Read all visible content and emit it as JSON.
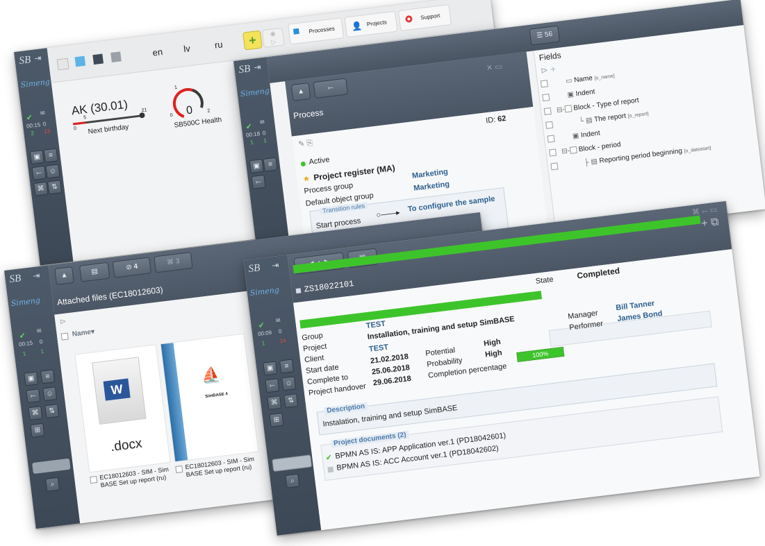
{
  "dashboard": {
    "languages": [
      "en",
      "lv",
      "ru"
    ],
    "toolbar": {
      "processes": "Processes",
      "projects": "Projects",
      "support": "Support"
    },
    "gauge1": {
      "title": "AK (30.01)",
      "min": "0",
      "marker": "5",
      "max": "21",
      "caption": "Next birthday"
    },
    "gauge2": {
      "top": "1",
      "min": "0",
      "max": "2",
      "value": "0",
      "caption": "SB500C Health"
    },
    "nav": {
      "time": "00:15",
      "mail": "0",
      "users": "2",
      "flags": "13"
    }
  },
  "process": {
    "badge": "56",
    "title": "Process",
    "id_label": "ID:",
    "id_value": "62",
    "status": "Active",
    "name": "Project register (MA)",
    "process_group_label": "Process group",
    "process_group": "Marketing",
    "default_group_label": "Default object group",
    "default_group": "Marketing",
    "transition_rules": "Transition rules",
    "start_process": "Start process",
    "configure": "To configure the sample",
    "nav": {
      "time": "00:18",
      "mail": "0",
      "users": "1",
      "flags": "1"
    }
  },
  "fields": {
    "title": "Fields",
    "items": [
      {
        "label": "Name",
        "code": "[o_name]"
      },
      {
        "label": "Indent",
        "code": ""
      },
      {
        "label": "Block - Type of report",
        "code": ""
      },
      {
        "label": "The report",
        "code": "[o_report]"
      },
      {
        "label": "Indent",
        "code": ""
      },
      {
        "label": "Block - period",
        "code": ""
      },
      {
        "label": "Reporting period beginning",
        "code": "[o_datestart]"
      }
    ]
  },
  "files": {
    "attach_count": "4",
    "network_count": "3",
    "title": "Attached files (EC18012603)",
    "column_name": "Name",
    "docx_ext": ".docx",
    "file1_name": "EC18012603 - SIM - Sim BASE Set up report (ru)",
    "file2_name": "EC18012603 - SIM - Sim BASE Set up report (ru)",
    "doc_heading": "SimBASE 4",
    "nav": {
      "time": "00:15",
      "mail": "0",
      "users": "1",
      "flags": "1"
    }
  },
  "project": {
    "code": "ZS18022101",
    "state_label": "State",
    "state": "Completed",
    "group_label": "Group",
    "group": "TEST",
    "project_label": "Project",
    "project": "Installation, training and setup SimBASE",
    "client_label": "Client",
    "client": "TEST",
    "start_label": "Start date",
    "start": "21.02.2018",
    "complete_label": "Complete to",
    "complete": "25.06.2018",
    "handover_label": "Project handover",
    "handover": "29.06.2018",
    "potential_label": "Potential",
    "potential": "High",
    "probability_label": "Probability",
    "probability": "High",
    "completion_label": "Completion percentage",
    "completion": "100%",
    "completion_fraction": 1.0,
    "manager_label": "Manager",
    "manager": "Bill Tanner",
    "performer_label": "Performer",
    "performer": "James Bond",
    "description_label": "Description",
    "description": "Instalation, training and setup SimBASE",
    "documents_label": "Project documents (2)",
    "documents": [
      {
        "text": "BPMN AS IS: APP Application ver.1 (PD18042601)",
        "checked": true
      },
      {
        "text": "BPMN AS IS: ACC Account ver.1 (PD18042602)",
        "checked": false
      }
    ],
    "nav": {
      "time": "00:09",
      "mail": "0",
      "users": "1",
      "flags": "14"
    }
  },
  "colors": {
    "nav": "#4a5563",
    "accent_green": "#3ec42b",
    "label_blue": "#2c5f8f",
    "gauge_red": "#e02020"
  }
}
